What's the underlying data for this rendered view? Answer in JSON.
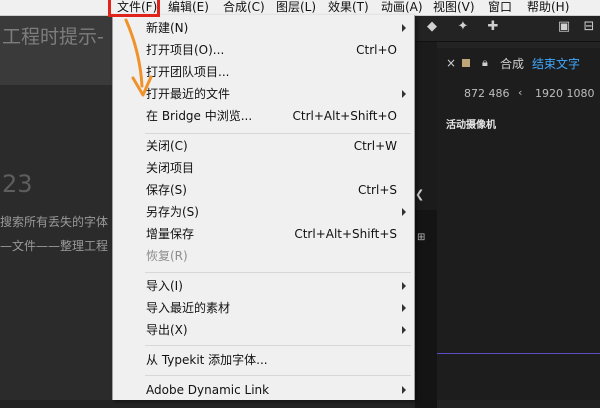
{
  "menubar": {
    "items": [
      "文件(F)",
      "编辑(E)",
      "合成(C)",
      "图层(L)",
      "效果(T)",
      "动画(A)",
      "视图(V)",
      "窗口",
      "帮助(H)"
    ]
  },
  "background": {
    "title_fragment": "工程时提示-",
    "number_fragment": "23",
    "line1_fragment": "搜索所有丢失的字体",
    "line2_fragment": "—文件——整理工程"
  },
  "panel": {
    "tab_label": "合成",
    "tab_value": "结束文字",
    "coords_left": "872 486",
    "coords_right": "1920 1080",
    "active_camera": "活动摄像机"
  },
  "file_menu": {
    "items": [
      {
        "label": "新建(N)",
        "shortcut": "",
        "submenu": true
      },
      {
        "label": "打开项目(O)...",
        "shortcut": "Ctrl+O",
        "submenu": false
      },
      {
        "label": "打开团队项目...",
        "shortcut": "",
        "submenu": false
      },
      {
        "label": "打开最近的文件",
        "shortcut": "",
        "submenu": true
      },
      {
        "label": "在 Bridge 中浏览...",
        "shortcut": "Ctrl+Alt+Shift+O",
        "submenu": false
      },
      {
        "label": "关闭(C)",
        "shortcut": "Ctrl+W",
        "submenu": false
      },
      {
        "label": "关闭项目",
        "shortcut": "",
        "submenu": false
      },
      {
        "label": "保存(S)",
        "shortcut": "Ctrl+S",
        "submenu": false
      },
      {
        "label": "另存为(S)",
        "shortcut": "",
        "submenu": true
      },
      {
        "label": "增量保存",
        "shortcut": "Ctrl+Alt+Shift+S",
        "submenu": false
      },
      {
        "label": "恢复(R)",
        "shortcut": "",
        "submenu": false,
        "disabled": true
      },
      {
        "label": "导入(I)",
        "shortcut": "",
        "submenu": true
      },
      {
        "label": "导入最近的素材",
        "shortcut": "",
        "submenu": true
      },
      {
        "label": "导出(X)",
        "shortcut": "",
        "submenu": true
      },
      {
        "label": "从 Typekit 添加字体...",
        "shortcut": "",
        "submenu": false
      },
      {
        "label": "Adobe Dynamic Link",
        "shortcut": "",
        "submenu": true
      }
    ]
  },
  "colors": {
    "highlight_box": "#e0241b",
    "annotation_arrow": "#f0922b",
    "accent_text": "#3fa9ff",
    "timeline_line": "#5a4fc0"
  }
}
